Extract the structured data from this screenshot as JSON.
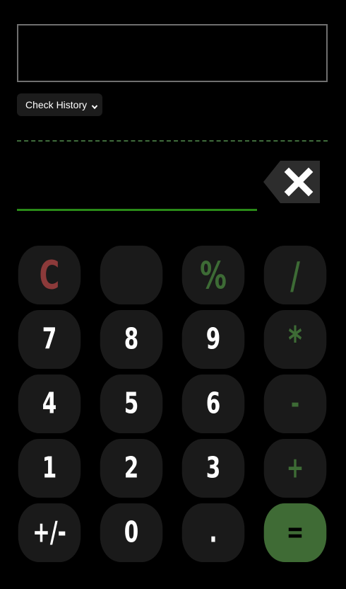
{
  "display": {
    "value": ""
  },
  "history": {
    "label": "Check History"
  },
  "input": {
    "value": ""
  },
  "colors": {
    "clear": "#8c3a3a",
    "operator": "#3d6b35",
    "equals_bg": "#3f6b35",
    "input_underline": "#2a8a18",
    "dashed_divider": "#3f6b3b",
    "key_bg": "#1a1a1a"
  },
  "keys": {
    "clear": "C",
    "blank": "",
    "percent": "%",
    "divide": "/",
    "seven": "7",
    "eight": "8",
    "nine": "9",
    "multiply": "*",
    "four": "4",
    "five": "5",
    "six": "6",
    "minus": "-",
    "one": "1",
    "two": "2",
    "three": "3",
    "plus": "+",
    "negate": "+/-",
    "zero": "0",
    "decimal": ".",
    "equals": "="
  },
  "icons": {
    "backspace": "backspace-icon",
    "dropdown": "chevron-down-icon"
  }
}
